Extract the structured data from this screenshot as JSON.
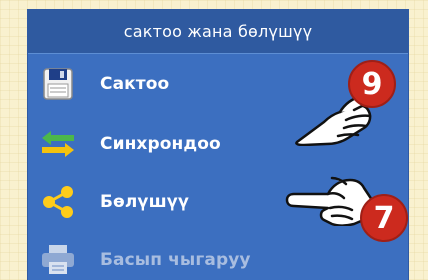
{
  "panel": {
    "title": "сактоо жана бөлүшүү",
    "items": [
      {
        "label": "Сактоо",
        "icon": "save-icon",
        "enabled": true
      },
      {
        "label": "Синхрондоо",
        "icon": "sync-arrows-icon",
        "enabled": true
      },
      {
        "label": "Бөлүшүү",
        "icon": "share-icon",
        "enabled": true
      },
      {
        "label": "Басып чыгаруу",
        "icon": "printer-icon",
        "enabled": false
      }
    ]
  },
  "callouts": [
    {
      "number": "9",
      "icon": "pointing-hand-icon"
    },
    {
      "number": "7",
      "icon": "pointing-hand-icon"
    }
  ],
  "colors": {
    "panel_bg": "#3c6fc0",
    "header_bg": "#2f5aa0",
    "badge": "#cc2a1e",
    "page_bg": "#f9f1cf"
  }
}
